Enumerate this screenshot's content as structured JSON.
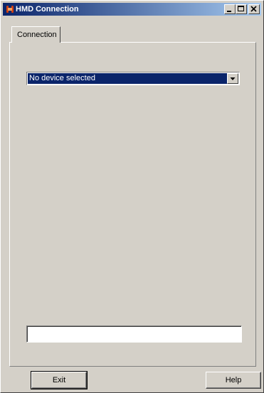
{
  "window": {
    "title": "HMD Connection",
    "app_icon": "hmd-app-icon",
    "controls": {
      "minimize": "minimize-icon",
      "maximize": "maximize-icon",
      "close": "close-icon"
    }
  },
  "tabs": [
    {
      "label": "Connection",
      "selected": true
    }
  ],
  "device_select": {
    "selected": "No device selected"
  },
  "status_field": {
    "value": ""
  },
  "buttons": {
    "exit": "Exit",
    "help": "Help"
  },
  "colors": {
    "titlebar_start": "#0a246a",
    "titlebar_end": "#a6caf0",
    "face": "#d4d0c8",
    "selection": "#0a246a"
  }
}
